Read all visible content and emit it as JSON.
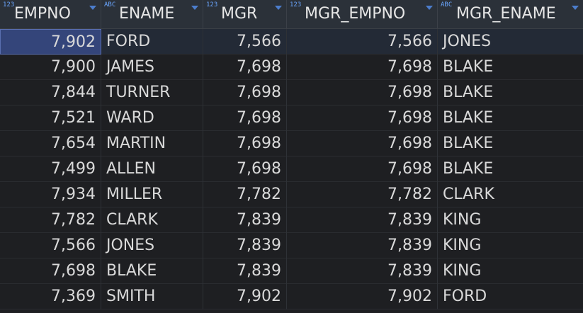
{
  "columns": [
    {
      "name": "EMPNO",
      "type_badge": "123"
    },
    {
      "name": "ENAME",
      "type_badge": "ABC"
    },
    {
      "name": "MGR",
      "type_badge": "123"
    },
    {
      "name": "MGR_EMPNO",
      "type_badge": "123"
    },
    {
      "name": "MGR_ENAME",
      "type_badge": "ABC"
    }
  ],
  "rows": [
    [
      "7,902",
      "FORD",
      "7,566",
      "7,566",
      "JONES"
    ],
    [
      "7,900",
      "JAMES",
      "7,698",
      "7,698",
      "BLAKE"
    ],
    [
      "7,844",
      "TURNER",
      "7,698",
      "7,698",
      "BLAKE"
    ],
    [
      "7,521",
      "WARD",
      "7,698",
      "7,698",
      "BLAKE"
    ],
    [
      "7,654",
      "MARTIN",
      "7,698",
      "7,698",
      "BLAKE"
    ],
    [
      "7,499",
      "ALLEN",
      "7,698",
      "7,698",
      "BLAKE"
    ],
    [
      "7,934",
      "MILLER",
      "7,782",
      "7,782",
      "CLARK"
    ],
    [
      "7,782",
      "CLARK",
      "7,839",
      "7,839",
      "KING"
    ],
    [
      "7,566",
      "JONES",
      "7,839",
      "7,839",
      "KING"
    ],
    [
      "7,698",
      "BLAKE",
      "7,839",
      "7,839",
      "KING"
    ],
    [
      "7,369",
      "SMITH",
      "7,902",
      "7,902",
      "FORD"
    ]
  ],
  "selected_row": 0,
  "colors": {
    "background": "#1e1f22",
    "header_bg": "#2b3139",
    "selected_row": "#232a36",
    "selected_cell": "#34457a",
    "type_badge": "#6aa6ff",
    "sort_caret": "#4c7dcc"
  }
}
